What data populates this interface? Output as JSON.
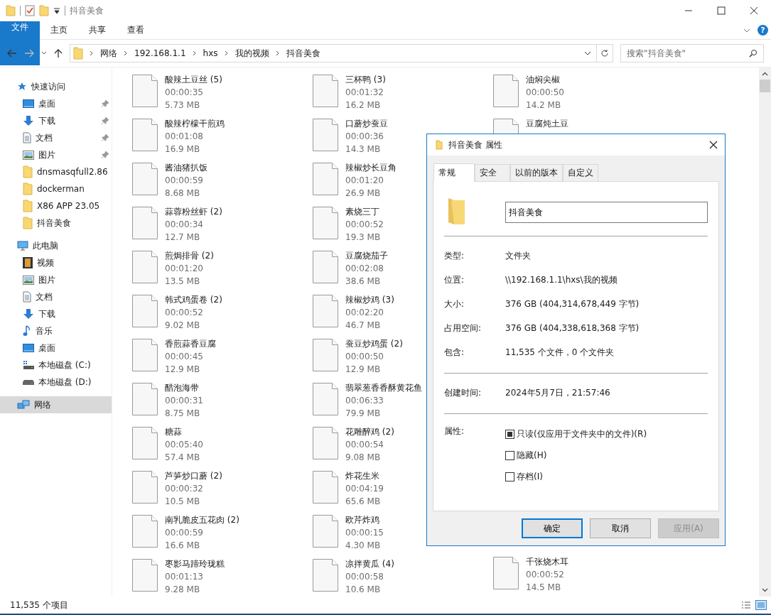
{
  "window": {
    "title": "抖音美食"
  },
  "ribbon": {
    "tabs": [
      {
        "label": "文件",
        "kind": "file",
        "selected": false
      },
      {
        "label": "主页",
        "kind": "tab",
        "selected": false
      },
      {
        "label": "共享",
        "kind": "tab",
        "selected": false
      },
      {
        "label": "查看",
        "kind": "tab",
        "selected": false
      }
    ],
    "help": "?"
  },
  "address": {
    "path": [
      "网络",
      "192.168.1.1",
      "hxs",
      "我的视频",
      "抖音美食"
    ],
    "search_placeholder": "搜索\"抖音美食\""
  },
  "sidebar": [
    {
      "label": "快速访问",
      "selected": false,
      "children": [
        {
          "label": "桌面",
          "pinned": true,
          "selected": false
        },
        {
          "label": "下载",
          "pinned": true,
          "selected": false
        },
        {
          "label": "文档",
          "pinned": true,
          "selected": false
        },
        {
          "label": "图片",
          "pinned": true,
          "selected": false
        },
        {
          "label": "dnsmasqfull2.86",
          "pinned": false,
          "selected": false
        },
        {
          "label": "dockerman",
          "pinned": false,
          "selected": false
        },
        {
          "label": "X86 APP 23.05",
          "pinned": false,
          "selected": false
        },
        {
          "label": "抖音美食",
          "pinned": false,
          "selected": false
        }
      ]
    },
    {
      "label": "此电脑",
      "selected": false,
      "children": [
        {
          "label": "视频",
          "pinned": false,
          "selected": false
        },
        {
          "label": "图片",
          "pinned": false,
          "selected": false
        },
        {
          "label": "文档",
          "pinned": false,
          "selected": false
        },
        {
          "label": "下载",
          "pinned": false,
          "selected": false
        },
        {
          "label": "音乐",
          "pinned": false,
          "selected": false
        },
        {
          "label": "桌面",
          "pinned": false,
          "selected": false
        },
        {
          "label": "本地磁盘 (C:)",
          "pinned": false,
          "selected": false
        },
        {
          "label": "本地磁盘 (D:)",
          "pinned": false,
          "selected": false
        }
      ]
    },
    {
      "label": "网络",
      "selected": true
    }
  ],
  "columns": [
    {
      "top": [
        {
          "name": "酸辣土豆丝 (5)",
          "duration": "00:00:35",
          "size": "5.73 MB"
        },
        {
          "name": "酸辣柠檬干煎鸡",
          "duration": "00:01:08",
          "size": "16.9 MB"
        },
        {
          "name": "酱油猪扒饭",
          "duration": "00:00:59",
          "size": "8.68 MB"
        },
        {
          "name": "蒜蓉粉丝虾 (2)",
          "duration": "00:00:34",
          "size": "12.7 MB"
        },
        {
          "name": "煎焗排骨 (2)",
          "duration": "00:01:20",
          "size": "13.5 MB"
        },
        {
          "name": "韩式鸡蛋卷 (2)",
          "duration": "00:00:52",
          "size": "9.02 MB"
        },
        {
          "name": "香煎蒜香豆腐",
          "duration": "00:00:45",
          "size": "12.9 MB"
        },
        {
          "name": "醋泡海带",
          "duration": "00:00:31",
          "size": "8.75 MB"
        },
        {
          "name": "糖蒜",
          "duration": "00:05:40",
          "size": "57.4 MB"
        },
        {
          "name": "芦笋炒口蘑 (2)",
          "duration": "00:00:32",
          "size": "10.5 MB"
        },
        {
          "name": "南乳脆皮五花肉 (2)",
          "duration": "00:00:59",
          "size": "16.6 MB"
        },
        {
          "name": "枣影马蹄玲珑糕",
          "duration": "00:01:13",
          "size": "9.28 MB"
        }
      ]
    },
    {
      "top": [
        {
          "name": "三杯鸭 (3)",
          "duration": "00:01:32",
          "size": "16.2 MB"
        },
        {
          "name": "口蘑炒蚕豆",
          "duration": "00:00:36",
          "size": "14.3 MB"
        },
        {
          "name": "辣椒炒长豆角",
          "duration": "00:01:20",
          "size": "26.9 MB"
        },
        {
          "name": "素烧三丁",
          "duration": "00:00:52",
          "size": "19.3 MB"
        },
        {
          "name": "豆腐烧茄子",
          "duration": "00:02:08",
          "size": "38.6 MB"
        },
        {
          "name": "辣椒炒鸡 (3)",
          "duration": "00:02:20",
          "size": "46.7 MB"
        },
        {
          "name": "蚕豆炒鸡蛋 (2)",
          "duration": "00:00:50",
          "size": "12.9 MB"
        },
        {
          "name": "翡翠葱香香酥黄花鱼",
          "duration": "00:06:33",
          "size": "79.9 MB"
        },
        {
          "name": "花雕醉鸡 (2)",
          "duration": "00:00:54",
          "size": "9.08 MB"
        },
        {
          "name": "炸花生米",
          "duration": "00:04:19",
          "size": "65.6 MB"
        },
        {
          "name": "欧芹炸鸡",
          "duration": "00:00:15",
          "size": "4.30 MB"
        },
        {
          "name": "凉拌黄瓜 (4)",
          "duration": "00:00:58",
          "size": "10.6 MB"
        }
      ]
    },
    {
      "top": [
        {
          "name": "油焖尖椒",
          "duration": "00:00:50",
          "size": "14.2 MB"
        },
        {
          "name": "豆腐炖土豆"
        }
      ],
      "bottom": [
        {
          "name": "千张烧木耳",
          "duration": "00:00:52",
          "size": "14.5 MB"
        }
      ]
    }
  ],
  "status_bar": {
    "count": "11,535 个项目"
  },
  "dialog": {
    "title": "抖音美食 属性",
    "tabs": [
      {
        "label": "常规",
        "selected": true
      },
      {
        "label": "安全",
        "selected": false
      },
      {
        "label": "以前的版本",
        "selected": false
      },
      {
        "label": "自定义",
        "selected": false
      }
    ],
    "name": "抖音美食",
    "info_groups": [
      [
        {
          "label": "类型:",
          "value": "文件夹"
        },
        {
          "label": "位置:",
          "value": "\\\\192.168.1.1\\hxs\\我的视频"
        },
        {
          "label": "大小:",
          "value": "376 GB (404,314,678,449 字节)"
        },
        {
          "label": "占用空间:",
          "value": "376 GB (404,338,618,368 字节)"
        },
        {
          "label": "包含:",
          "value": "11,535 个文件，0 个文件夹"
        }
      ],
      [
        {
          "label": "创建时间:",
          "value": "2024年5月7日，21:57:46"
        }
      ]
    ],
    "attributes_label": "属性:",
    "attributes": [
      {
        "label": "只读(仅应用于文件夹中的文件)(R)",
        "checked": true
      },
      {
        "label": "隐藏(H)",
        "checked": false
      },
      {
        "label": "存档(I)",
        "checked": false
      }
    ],
    "buttons": [
      {
        "label": "确定",
        "default": true,
        "disabled": false
      },
      {
        "label": "取消",
        "default": false,
        "disabled": false
      },
      {
        "label": "应用(A)",
        "default": false,
        "disabled": true
      }
    ]
  }
}
